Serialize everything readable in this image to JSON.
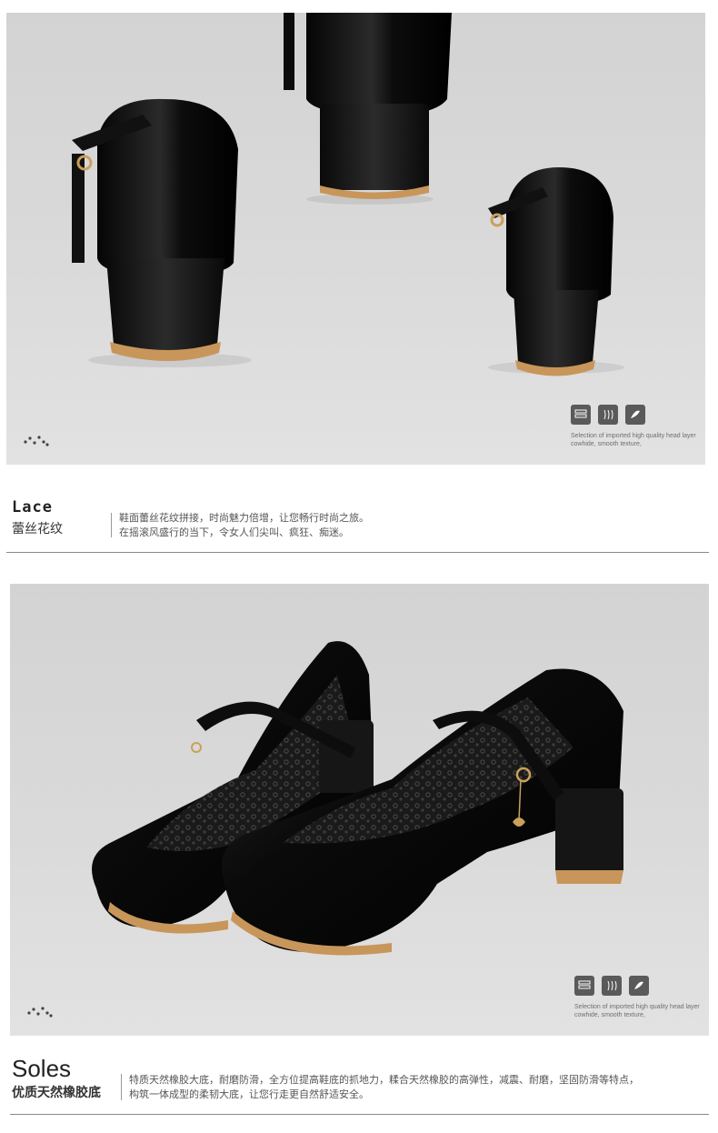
{
  "section_lace": {
    "heading_en": "Lace",
    "heading_zh": "蕾丝花纹",
    "description_lines": [
      "鞋面蕾丝花纹拼接，时尚魅力倍增，让您畅行时尚之旅。",
      "在摇滚风盛行的当下，令女人们尖叫、疯狂、痴迷。"
    ]
  },
  "section_soles": {
    "heading_en": "Soles",
    "heading_zh": "优质天然橡胶底",
    "description_lines": [
      "特质天然橡胶大底，耐磨防滑，全方位提高鞋底的抓地力，糅合天然橡胶的高弹性，减震、耐磨，坚固防滑等特点，",
      "构筑一体成型的柔韧大底，让您行走更自然舒适安全。"
    ]
  },
  "photo_rear": {
    "feature_caption": "Selection of imported high quality head layer cowhide, smooth texture,",
    "feature_icons": [
      "leather-layers-icon",
      "breathable-waves-icon",
      "soft-feather-icon"
    ]
  },
  "photo_front": {
    "feature_caption": "Selection of imported high quality head layer cowhide, smooth texture,",
    "feature_icons": [
      "leather-layers-icon",
      "breathable-waves-icon",
      "soft-feather-icon"
    ]
  },
  "colors": {
    "photo_bg": "#d6d6d6",
    "shoe_black": "#101010",
    "sole_tan": "#c8965a",
    "text_dark": "#222222",
    "text_body": "#555555",
    "rule": "#8a8a8a"
  }
}
